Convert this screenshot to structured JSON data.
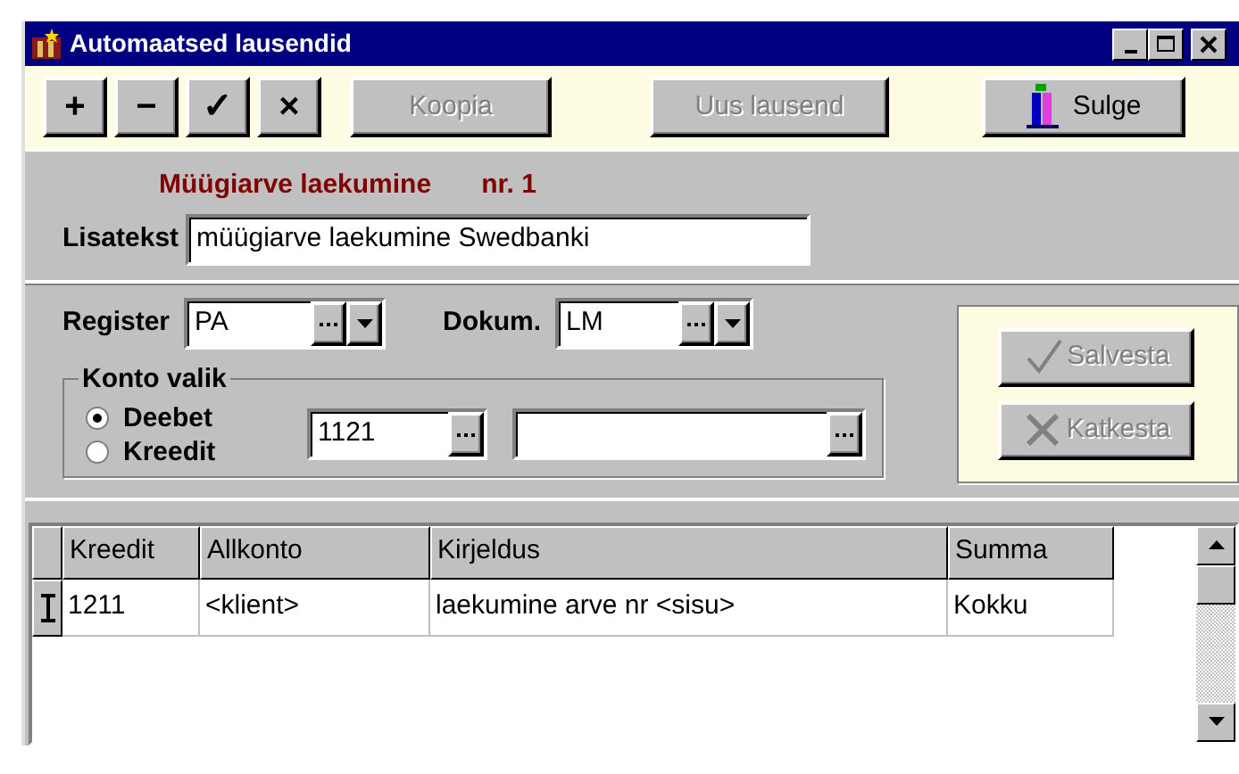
{
  "window": {
    "title": "Automaatsed lausendid"
  },
  "toolbar": {
    "record_buttons": [
      {
        "label": "+"
      },
      {
        "label": "−"
      },
      {
        "label": "✓"
      },
      {
        "label": "×"
      }
    ],
    "buttons": [
      {
        "label": "Koopia",
        "disabled": true,
        "kind": "text"
      },
      {
        "label": "Uus lausend",
        "disabled": true,
        "kind": "text"
      },
      {
        "label": "Sulge",
        "disabled": false,
        "kind": "exit"
      }
    ]
  },
  "header": {
    "title": "Müügiarve laekumine",
    "number": "nr. 1"
  },
  "lisatekst": {
    "label": "Lisatekst",
    "value": "müügiarve laekumine Swedbanki"
  },
  "register": {
    "label": "Register",
    "value": "PA"
  },
  "dokum": {
    "label": "Dokum.",
    "value": "LM"
  },
  "konto_valik": {
    "title": "Konto valik",
    "options": [
      {
        "label": "Deebet",
        "selected": true
      },
      {
        "label": "Kreedit",
        "selected": false
      }
    ],
    "account": "1121"
  },
  "actions": [
    {
      "label": "Salvesta",
      "disabled": true,
      "kind": "save"
    },
    {
      "label": "Katkesta",
      "disabled": true,
      "kind": "cancel"
    }
  ],
  "table": {
    "columns": [
      "Kreedit",
      "Allkonto",
      "Kirjeldus",
      "Summa"
    ],
    "rows": [
      [
        "1211",
        "<klient>",
        "laekumine arve nr <sisu>",
        "Kokku"
      ]
    ]
  }
}
